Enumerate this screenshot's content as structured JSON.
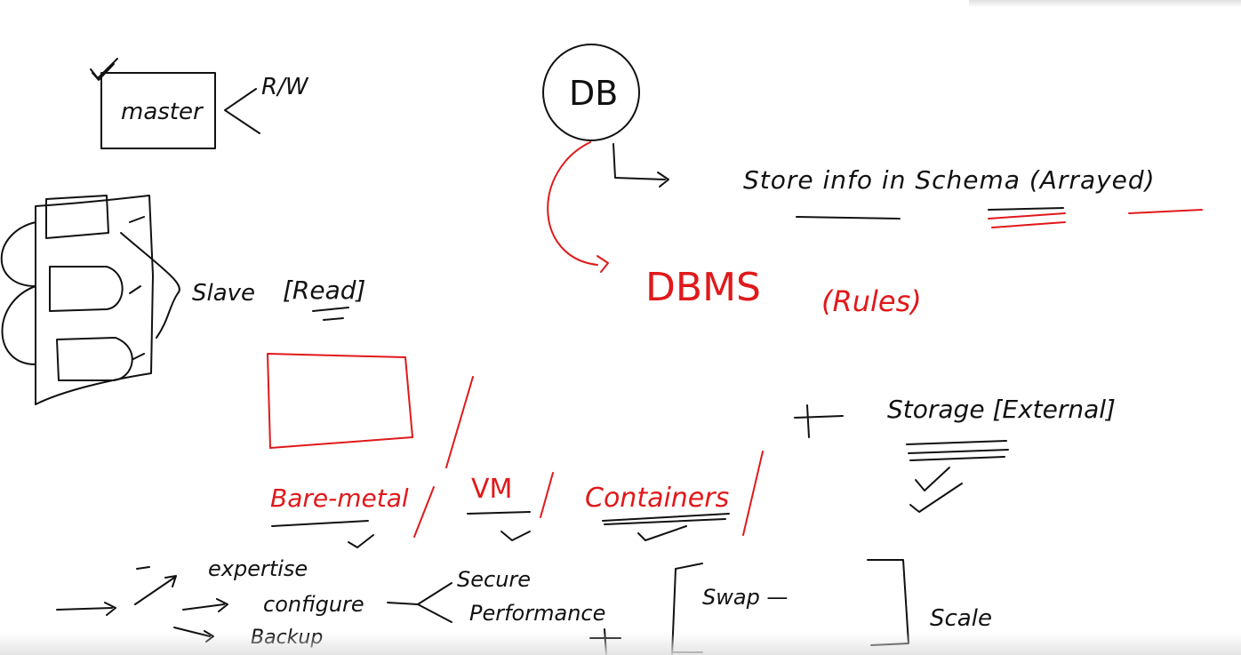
{
  "colors": {
    "ink_black": "#111111",
    "ink_red": "#e0191b"
  },
  "labels": {
    "master": "master",
    "rw": "R/W",
    "slave": "Slave",
    "read": "[Read]",
    "db": "DB",
    "store_info": "Store info in Schema (Arrayed)",
    "dbms": "DBMS",
    "rules": "(Rules)",
    "storage": "Storage [External]",
    "bare_metal": "Bare-metal",
    "vm": "VM",
    "containers": "Containers",
    "expertise": "expertise",
    "configure": "configure",
    "backup": "Backup",
    "secure": "Secure",
    "performance": "Performance",
    "swap": "Swap —",
    "scale": "Scale"
  }
}
